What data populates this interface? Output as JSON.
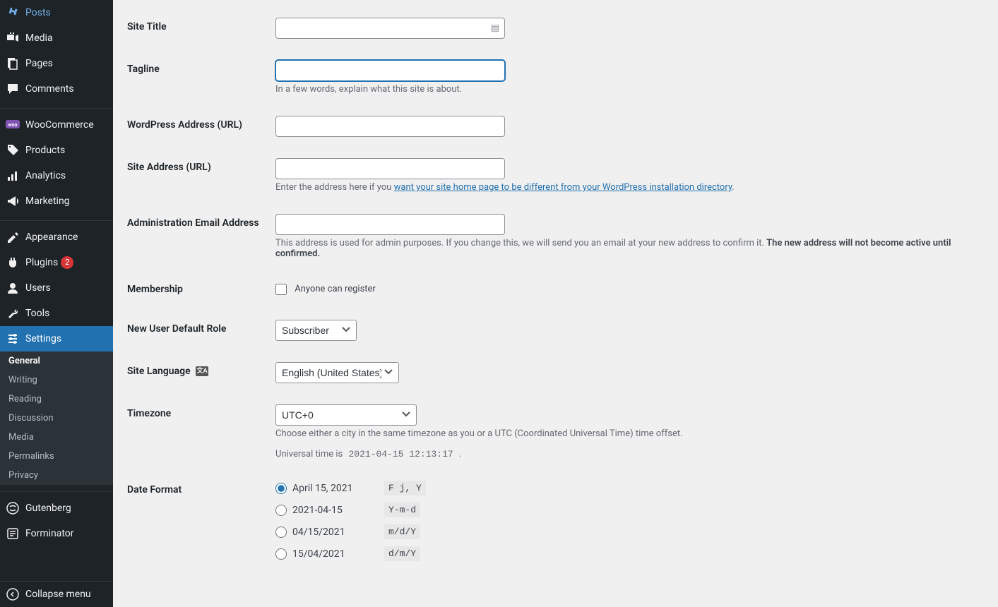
{
  "sidebar": {
    "posts": "Posts",
    "media": "Media",
    "pages": "Pages",
    "comments": "Comments",
    "woocommerce": "WooCommerce",
    "products": "Products",
    "analytics": "Analytics",
    "marketing": "Marketing",
    "appearance": "Appearance",
    "plugins": "Plugins",
    "plugins_badge": "2",
    "users": "Users",
    "tools": "Tools",
    "settings": "Settings",
    "gutenberg": "Gutenberg",
    "forminator": "Forminator",
    "collapse": "Collapse menu"
  },
  "submenu": {
    "general": "General",
    "writing": "Writing",
    "reading": "Reading",
    "discussion": "Discussion",
    "media": "Media",
    "permalinks": "Permalinks",
    "privacy": "Privacy"
  },
  "fields": {
    "site_title": {
      "label": "Site Title",
      "value": ""
    },
    "tagline": {
      "label": "Tagline",
      "value": "",
      "desc": "In a few words, explain what this site is about."
    },
    "wp_url": {
      "label": "WordPress Address (URL)",
      "value": ""
    },
    "site_url": {
      "label": "Site Address (URL)",
      "value": "",
      "desc_prefix": "Enter the address here if you ",
      "desc_link": "want your site home page to be different from your WordPress installation directory",
      "desc_suffix": "."
    },
    "admin_email": {
      "label": "Administration Email Address",
      "value": "",
      "desc_plain": "This address is used for admin purposes. If you change this, we will send you an email at your new address to confirm it. ",
      "desc_strong": "The new address will not become active until confirmed."
    },
    "membership": {
      "label": "Membership",
      "checkbox_label": "Anyone can register"
    },
    "default_role": {
      "label": "New User Default Role",
      "value": "Subscriber"
    },
    "site_language": {
      "label": "Site Language",
      "value": "English (United States)"
    },
    "timezone": {
      "label": "Timezone",
      "value": "UTC+0",
      "desc": "Choose either a city in the same timezone as you or a UTC (Coordinated Universal Time) time offset.",
      "utc_prefix": "Universal time is ",
      "utc_value": "2021-04-15 12:13:17",
      "utc_suffix": " ."
    },
    "date_format": {
      "label": "Date Format",
      "options": [
        {
          "display": "April 15, 2021",
          "code": "F j, Y",
          "checked": true
        },
        {
          "display": "2021-04-15",
          "code": "Y-m-d",
          "checked": false
        },
        {
          "display": "04/15/2021",
          "code": "m/d/Y",
          "checked": false
        },
        {
          "display": "15/04/2021",
          "code": "d/m/Y",
          "checked": false
        }
      ]
    }
  }
}
